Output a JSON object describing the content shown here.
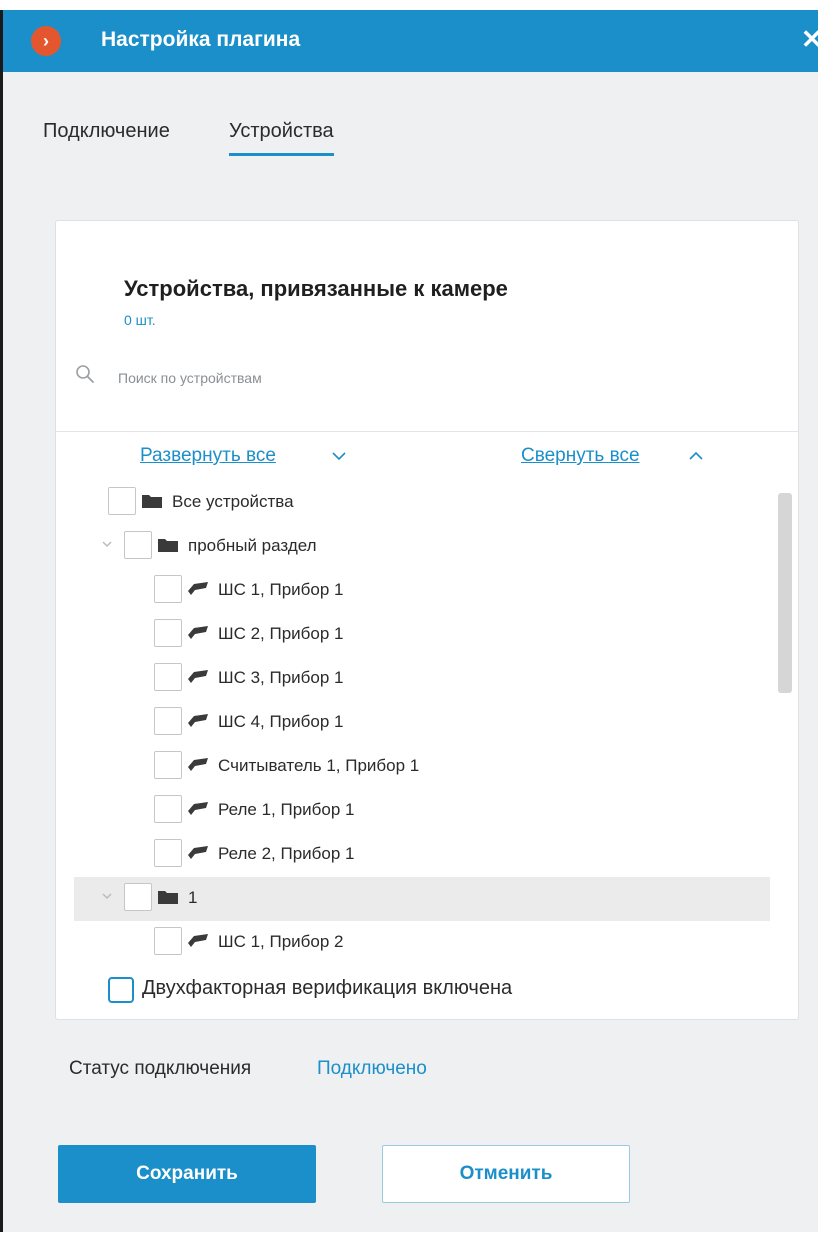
{
  "window": {
    "title": "Настройка плагина",
    "logo_glyph": "›",
    "close_glyph": "✕"
  },
  "tabs": [
    {
      "label": "Подключение",
      "active": false
    },
    {
      "label": "Устройства",
      "active": true
    }
  ],
  "panel": {
    "title": "Устройства, привязанные к камере",
    "count": "0 шт.",
    "search_placeholder": "Поиск по устройствам",
    "expand_all": "Развернуть все",
    "collapse_all": "Свернуть все"
  },
  "tree": [
    {
      "label": "Все устройства",
      "icon": "folder-icon",
      "level": 0,
      "expander": false,
      "highlight": false
    },
    {
      "label": "пробный раздел",
      "icon": "folder-icon",
      "level": 1,
      "expander": true,
      "highlight": false
    },
    {
      "label": "ШС 1, Прибор 1",
      "icon": "sensor-icon",
      "level": 2,
      "expander": false,
      "highlight": false
    },
    {
      "label": "ШС 2, Прибор 1",
      "icon": "sensor-icon",
      "level": 2,
      "expander": false,
      "highlight": false
    },
    {
      "label": "ШС 3, Прибор 1",
      "icon": "sensor-icon",
      "level": 2,
      "expander": false,
      "highlight": false
    },
    {
      "label": "ШС 4, Прибор 1",
      "icon": "sensor-icon",
      "level": 2,
      "expander": false,
      "highlight": false
    },
    {
      "label": "Считыватель 1, Прибор 1",
      "icon": "sensor-icon",
      "level": 2,
      "expander": false,
      "highlight": false
    },
    {
      "label": "Реле 1, Прибор 1",
      "icon": "sensor-icon",
      "level": 2,
      "expander": false,
      "highlight": false
    },
    {
      "label": "Реле 2, Прибор 1",
      "icon": "sensor-icon",
      "level": 2,
      "expander": false,
      "highlight": false
    },
    {
      "label": "1",
      "icon": "folder-icon",
      "level": 1,
      "expander": true,
      "highlight": true
    },
    {
      "label": "ШС 1, Прибор 2",
      "icon": "sensor-icon",
      "level": 2,
      "expander": false,
      "highlight": false
    }
  ],
  "two_factor": {
    "label": "Двухфакторная верификация включена",
    "checked": false
  },
  "status": {
    "label": "Статус подключения",
    "value": "Подключено"
  },
  "buttons": {
    "save": "Сохранить",
    "cancel": "Отменить"
  },
  "colors": {
    "accent": "#1b8fc9",
    "logo": "#e4572e",
    "background": "#eef0f2"
  }
}
